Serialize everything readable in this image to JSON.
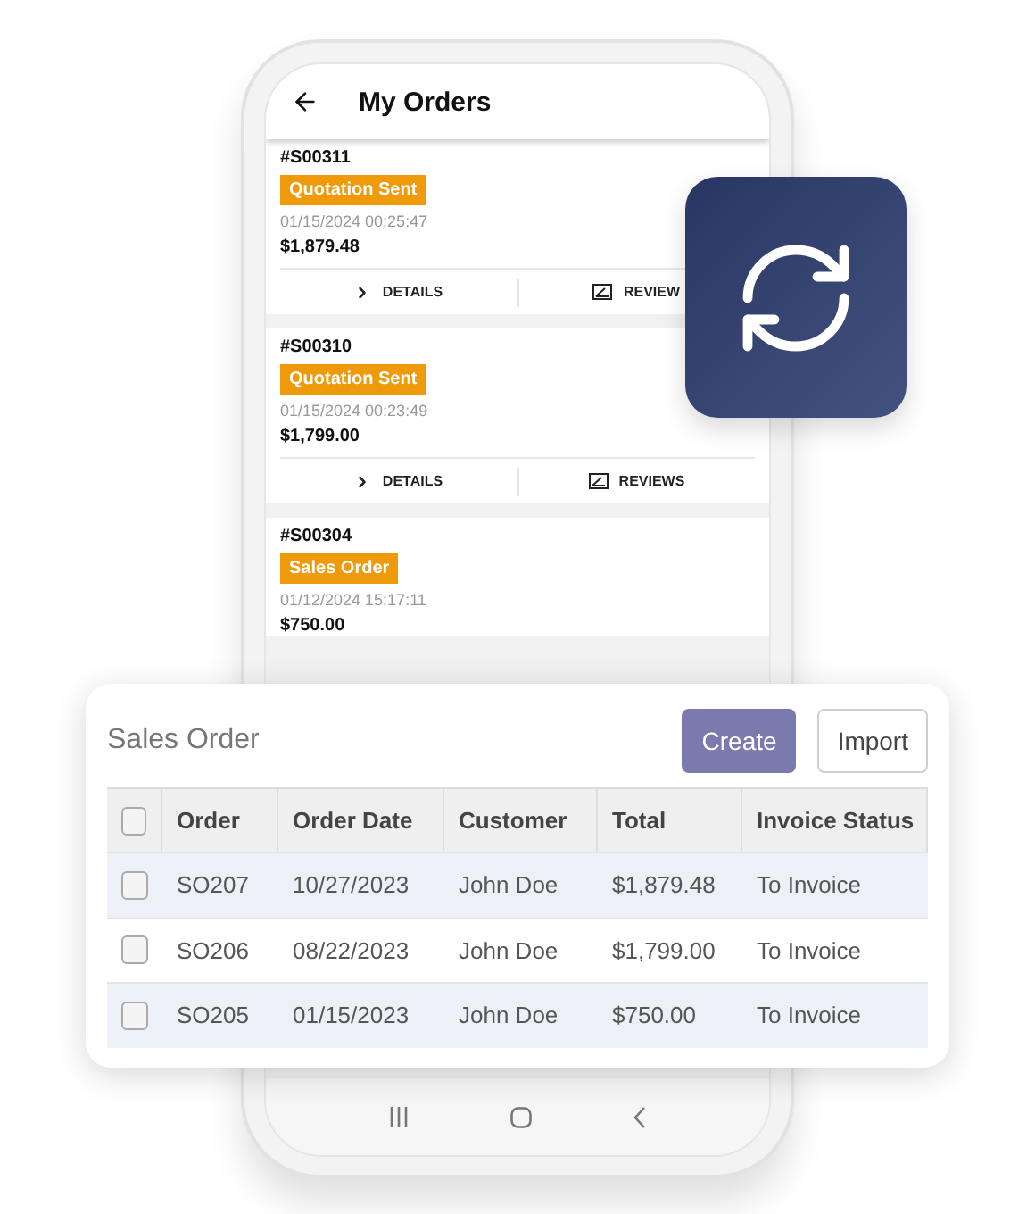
{
  "mobile_screen": {
    "title": "My Orders",
    "orders": [
      {
        "number": "#S00311",
        "status": "Quotation Sent",
        "date": "01/15/2024 00:25:47",
        "amount": "$1,879.48",
        "actions": [
          "DETAILS",
          "REVIEW"
        ]
      },
      {
        "number": "#S00310",
        "status": "Quotation Sent",
        "date": "01/15/2024 00:23:49",
        "amount": "$1,799.00",
        "actions": [
          "DETAILS",
          "REVIEWS"
        ]
      },
      {
        "number": "#S00304",
        "status": "Sales Order",
        "date": "01/12/2024 15:17:11",
        "amount": "$750.00"
      }
    ]
  },
  "sales_order": {
    "title": "Sales Order",
    "buttons": [
      {
        "label": "Create",
        "kind": "primary"
      },
      {
        "label": "Import",
        "kind": "secondary"
      }
    ],
    "header_checked": false,
    "columns": [
      "Order",
      "Order Date",
      "Customer",
      "Total",
      "Invoice Status"
    ],
    "rows": [
      {
        "checked": false,
        "cells": [
          "SO207",
          "10/27/2023",
          "John Doe",
          "$1,879.48",
          "To Invoice"
        ]
      },
      {
        "checked": false,
        "cells": [
          "SO206",
          "08/22/2023",
          "John Doe",
          "$1,799.00",
          "To Invoice"
        ]
      },
      {
        "checked": false,
        "cells": [
          "SO205",
          "01/15/2023",
          "John Doe",
          "$750.00",
          "To Invoice"
        ]
      }
    ]
  }
}
